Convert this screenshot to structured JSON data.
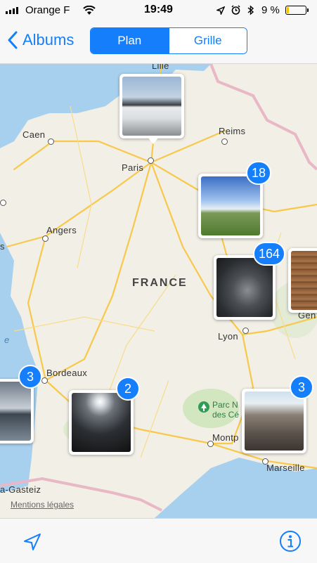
{
  "status_bar": {
    "carrier": "Orange F",
    "time": "19:49",
    "battery_percent": "9 %"
  },
  "nav": {
    "back_label": "Albums",
    "segments": [
      "Plan",
      "Grille"
    ],
    "selected_segment": "Plan"
  },
  "map": {
    "country_label": "FRANCE",
    "cities": [
      "Lille",
      "Caen",
      "Reims",
      "Paris",
      "Angers",
      "Lyon",
      "Bordeaux",
      "Montp",
      "Marseille",
      "a-Gasteiz",
      "Gen",
      "e"
    ],
    "park_label_line1": "Parc N",
    "park_label_line2": "des Cé",
    "legal_link": "Mentions légales"
  },
  "clusters": [
    {
      "name": "paris-cluster",
      "count": ""
    },
    {
      "name": "reims-cluster",
      "count": "18"
    },
    {
      "name": "east-cluster",
      "count": "164"
    },
    {
      "name": "bordeaux-cluster",
      "count": "3"
    },
    {
      "name": "south-cluster",
      "count": "2"
    },
    {
      "name": "marseille-cluster",
      "count": "3"
    }
  ],
  "colors": {
    "accent": "#147efb",
    "land": "#f2efe6",
    "water": "#a7d0ef",
    "road": "#f7c84a"
  },
  "toolbar": {
    "locate_icon": "location-arrow-icon",
    "info_icon": "info-icon"
  }
}
